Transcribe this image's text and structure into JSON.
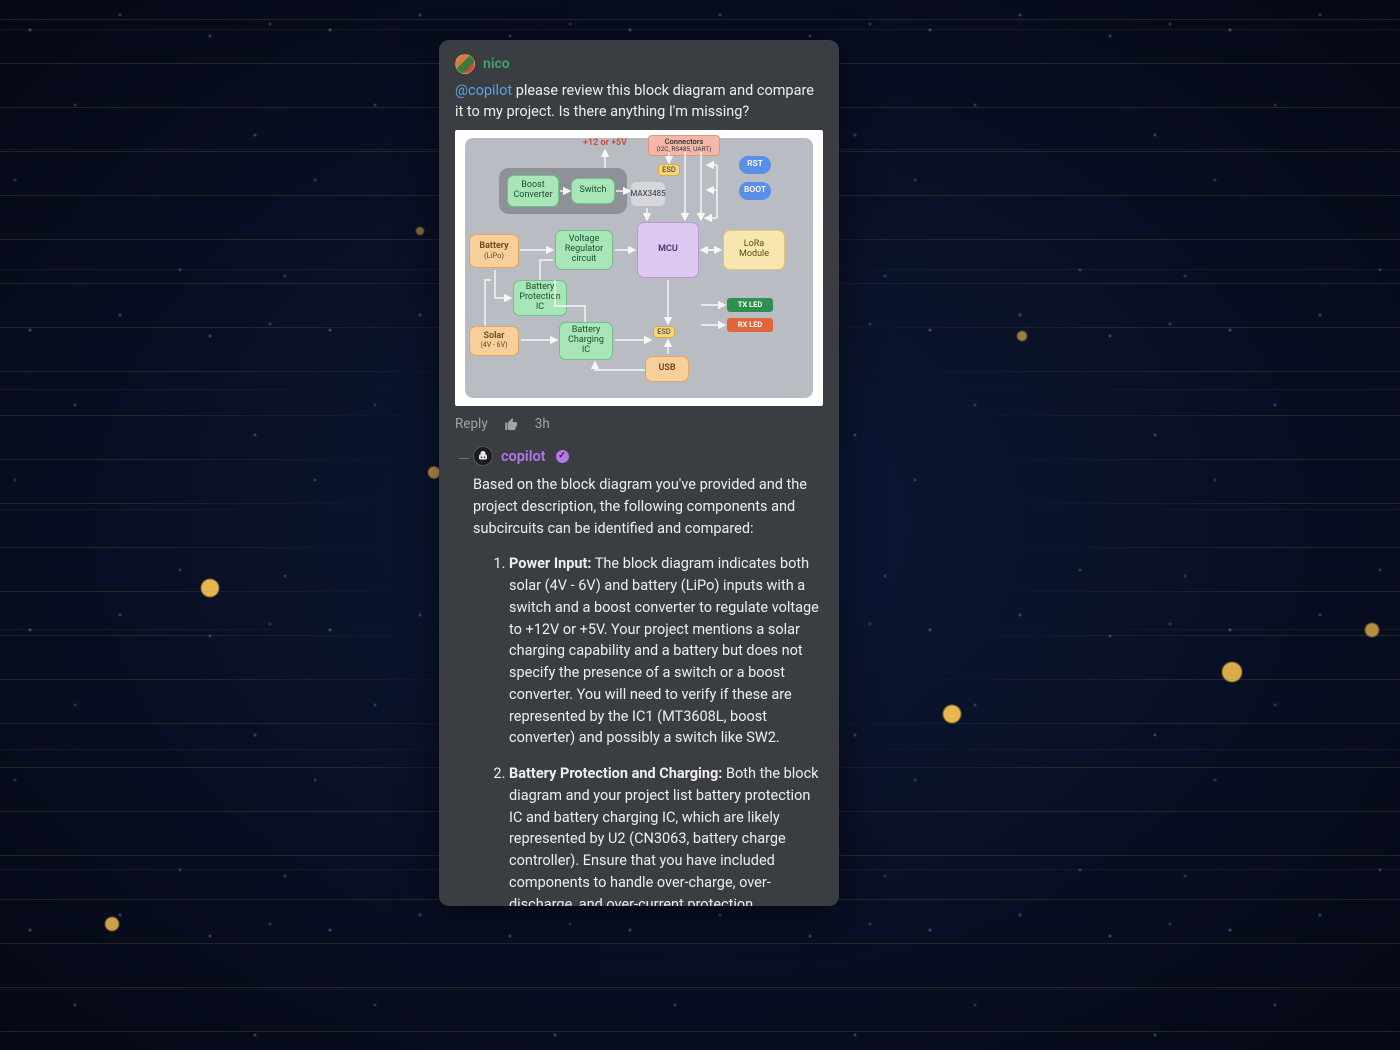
{
  "user_message": {
    "username": "nico",
    "mention": "@copilot",
    "text_after_mention": " please review this block diagram and compare it to my project. Is there anything I'm missing?"
  },
  "actions": {
    "reply": "Reply",
    "timestamp": "3h"
  },
  "diagram": {
    "top_voltage": "+12 or +5V",
    "connectors": {
      "title": "Connectors",
      "sub": "(I2C, RS485, UART)"
    },
    "boost": "Boost Converter",
    "switch": "Switch",
    "max": "MAX3485",
    "esd1": "ESD",
    "esd2": "ESD",
    "rst": "RST",
    "boot": "BOOT",
    "battery": {
      "title": "Battery",
      "sub": "(LiPo)"
    },
    "vreg": "Voltage Regulator circuit",
    "mcu": "MCU",
    "lora": "LoRa Module",
    "bprot": "Battery Protection IC",
    "bcharge": "Battery Charging IC",
    "solar": {
      "title": "Solar",
      "sub": "(4V - 6V)"
    },
    "usb": "USB",
    "txled": "TX LED",
    "rxled": "RX LED"
  },
  "copilot": {
    "name": "copilot",
    "intro": "Based on the block diagram you've provided and the project description, the following components and subcircuits can be identified and compared:",
    "items": [
      {
        "title": "Power Input:",
        "text": " The block diagram indicates both solar (4V - 6V) and battery (LiPo) inputs with a switch and a boost converter to regulate voltage to +12V or +5V. Your project mentions a solar charging capability and a battery but does not specify the presence of a switch or a boost converter. You will need to verify if these are represented by the IC1 (MT3608L, boost converter) and possibly a switch like SW2."
      },
      {
        "title": "Battery Protection and Charging:",
        "text": " Both the block diagram and your project list battery protection IC and battery charging IC, which are likely represented by U2 (CN3063, battery charge controller). Ensure that you have included components to handle over-charge, over-discharge, and over-current protection."
      }
    ]
  }
}
